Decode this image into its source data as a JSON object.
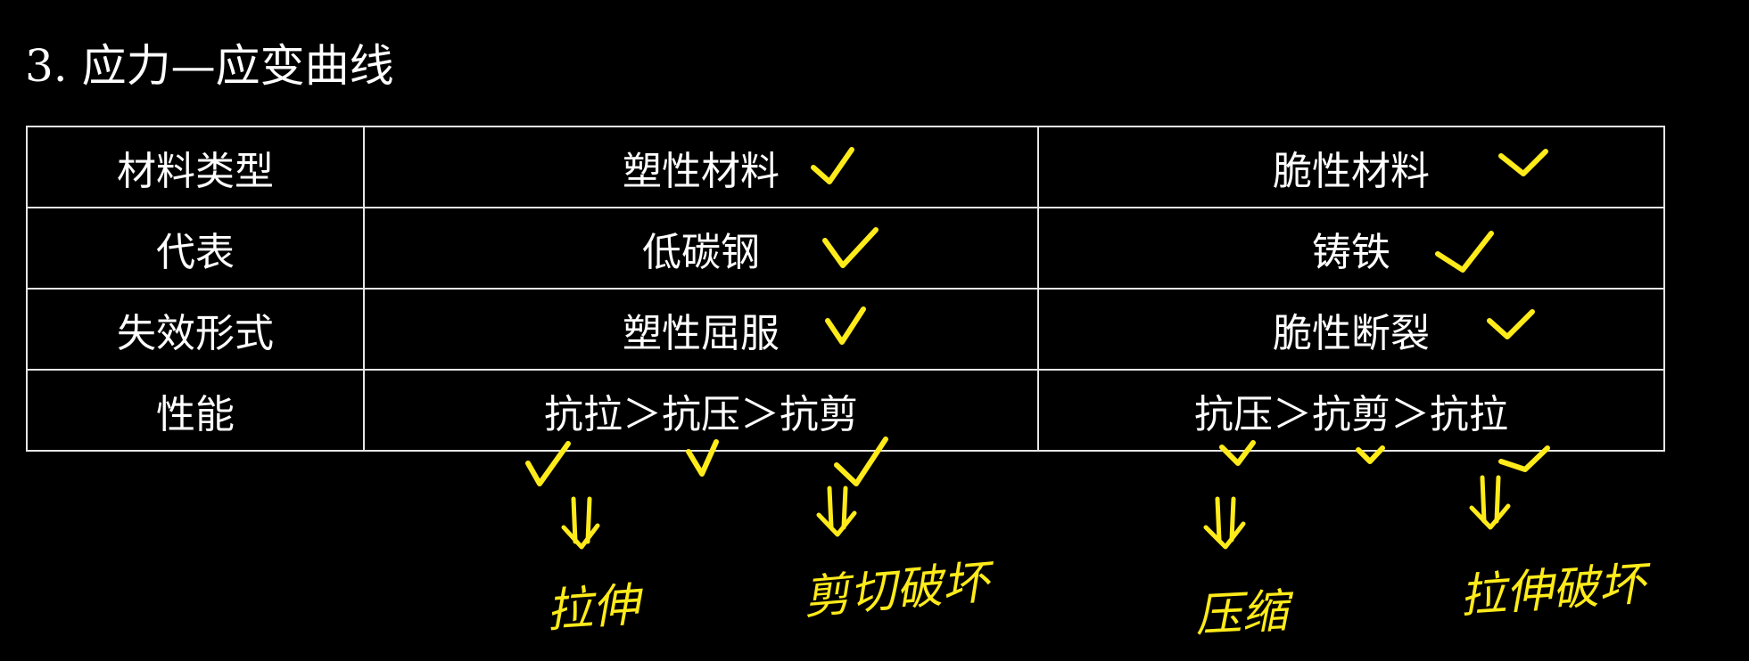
{
  "title": "3. 应力—应变曲线",
  "table": {
    "rows": [
      {
        "label": "材料类型",
        "plastic": "塑性材料",
        "brittle": "脆性材料"
      },
      {
        "label": "代表",
        "plastic": "低碳钢",
        "brittle": "铸铁"
      },
      {
        "label": "失效形式",
        "plastic": "塑性屈服",
        "brittle": "脆性断裂"
      },
      {
        "label": "性能",
        "plastic": "抗拉＞抗压＞抗剪",
        "brittle": "抗压＞抗剪＞抗拉"
      }
    ]
  },
  "annotations": {
    "plastic_tension": "拉伸",
    "plastic_shear": "剪切破坏",
    "brittle_compression": "压缩",
    "brittle_tension": "拉伸破坏"
  },
  "colors": {
    "background": "#000000",
    "text": "#ffffff",
    "grid": "#e6e6e6",
    "annotation": "#ffeb1a"
  },
  "icons": {
    "mark": "checkmark-icon",
    "arrow": "double-down-arrow-icon"
  }
}
